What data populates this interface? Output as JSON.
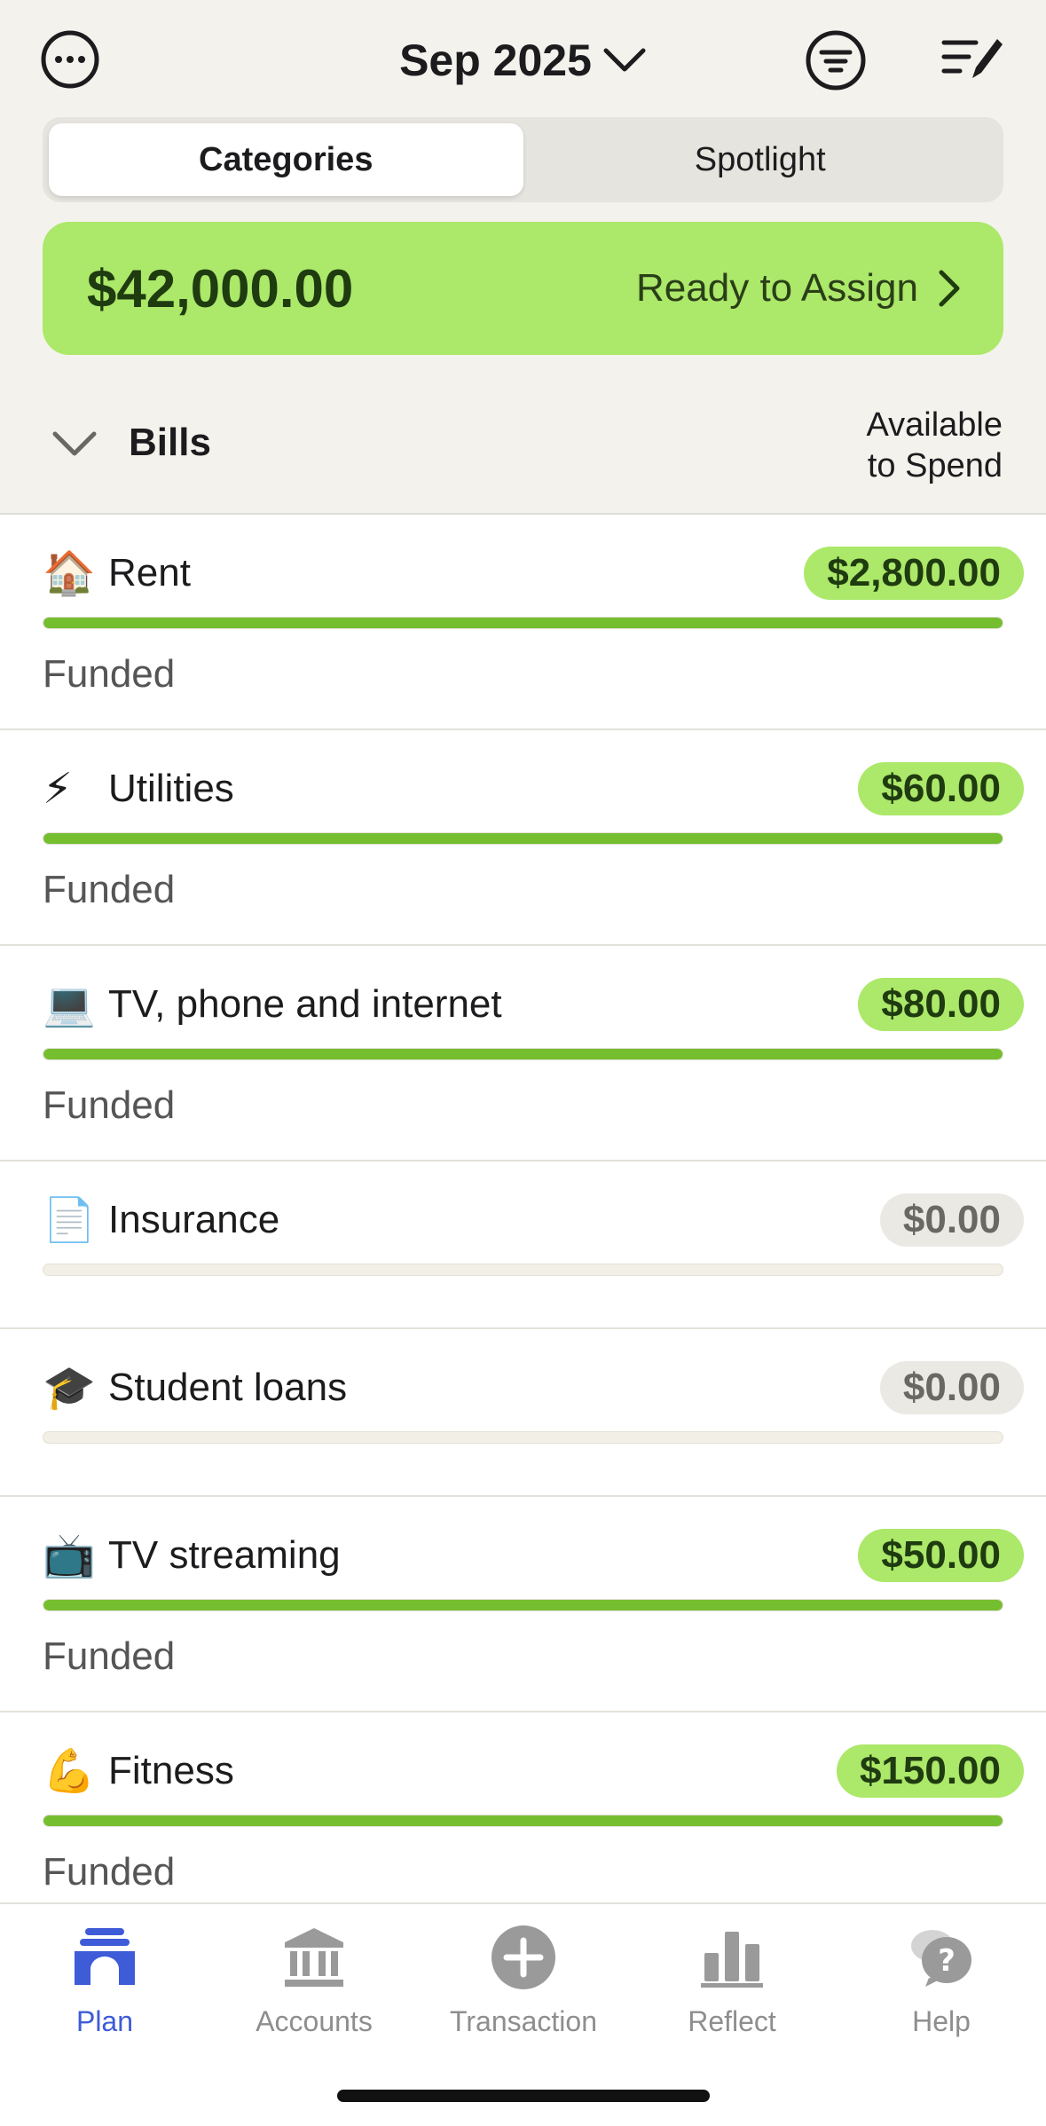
{
  "header": {
    "month": "Sep 2025",
    "icons": {
      "more": "more-circle-icon",
      "filter": "filter-icon",
      "edit": "edit-list-icon",
      "month_dropdown": "chevron-down-icon"
    }
  },
  "segments": {
    "categories": "Categories",
    "spotlight": "Spotlight",
    "selected": "Categories"
  },
  "ready_to_assign": {
    "amount": "$42,000.00",
    "label": "Ready to Assign"
  },
  "group": {
    "name": "Bills",
    "column_line1": "Available",
    "column_line2": "to Spend"
  },
  "categories": [
    {
      "emoji": "🏠",
      "name": "Rent",
      "amount": "$2,800.00",
      "status": "Funded",
      "progress": 1.0,
      "funded": true
    },
    {
      "emoji": "⚡",
      "name": "Utilities",
      "amount": "$60.00",
      "status": "Funded",
      "progress": 1.0,
      "funded": true
    },
    {
      "emoji": "💻",
      "name": "TV, phone and internet",
      "amount": "$80.00",
      "status": "Funded",
      "progress": 1.0,
      "funded": true
    },
    {
      "emoji": "📄",
      "name": "Insurance",
      "amount": "$0.00",
      "status": "",
      "progress": 0.0,
      "funded": false
    },
    {
      "emoji": "🎓",
      "name": "Student loans",
      "amount": "$0.00",
      "status": "",
      "progress": 0.0,
      "funded": false
    },
    {
      "emoji": "📺",
      "name": "TV streaming",
      "amount": "$50.00",
      "status": "Funded",
      "progress": 1.0,
      "funded": true
    },
    {
      "emoji": "💪",
      "name": "Fitness",
      "amount": "$150.00",
      "status": "Funded",
      "progress": 1.0,
      "funded": true
    }
  ],
  "tabs": [
    {
      "label": "Plan",
      "icon": "plan-icon",
      "active": true
    },
    {
      "label": "Accounts",
      "icon": "bank-icon",
      "active": false
    },
    {
      "label": "Transaction",
      "icon": "plus-circle-icon",
      "active": false
    },
    {
      "label": "Reflect",
      "icon": "bar-chart-icon",
      "active": false
    },
    {
      "label": "Help",
      "icon": "help-bubble-icon",
      "active": false
    }
  ],
  "colors": {
    "accent_green": "#ace869",
    "bar_green": "#75be2f",
    "tab_active": "#3e5bd8",
    "header_bg": "#f4f2ec"
  }
}
